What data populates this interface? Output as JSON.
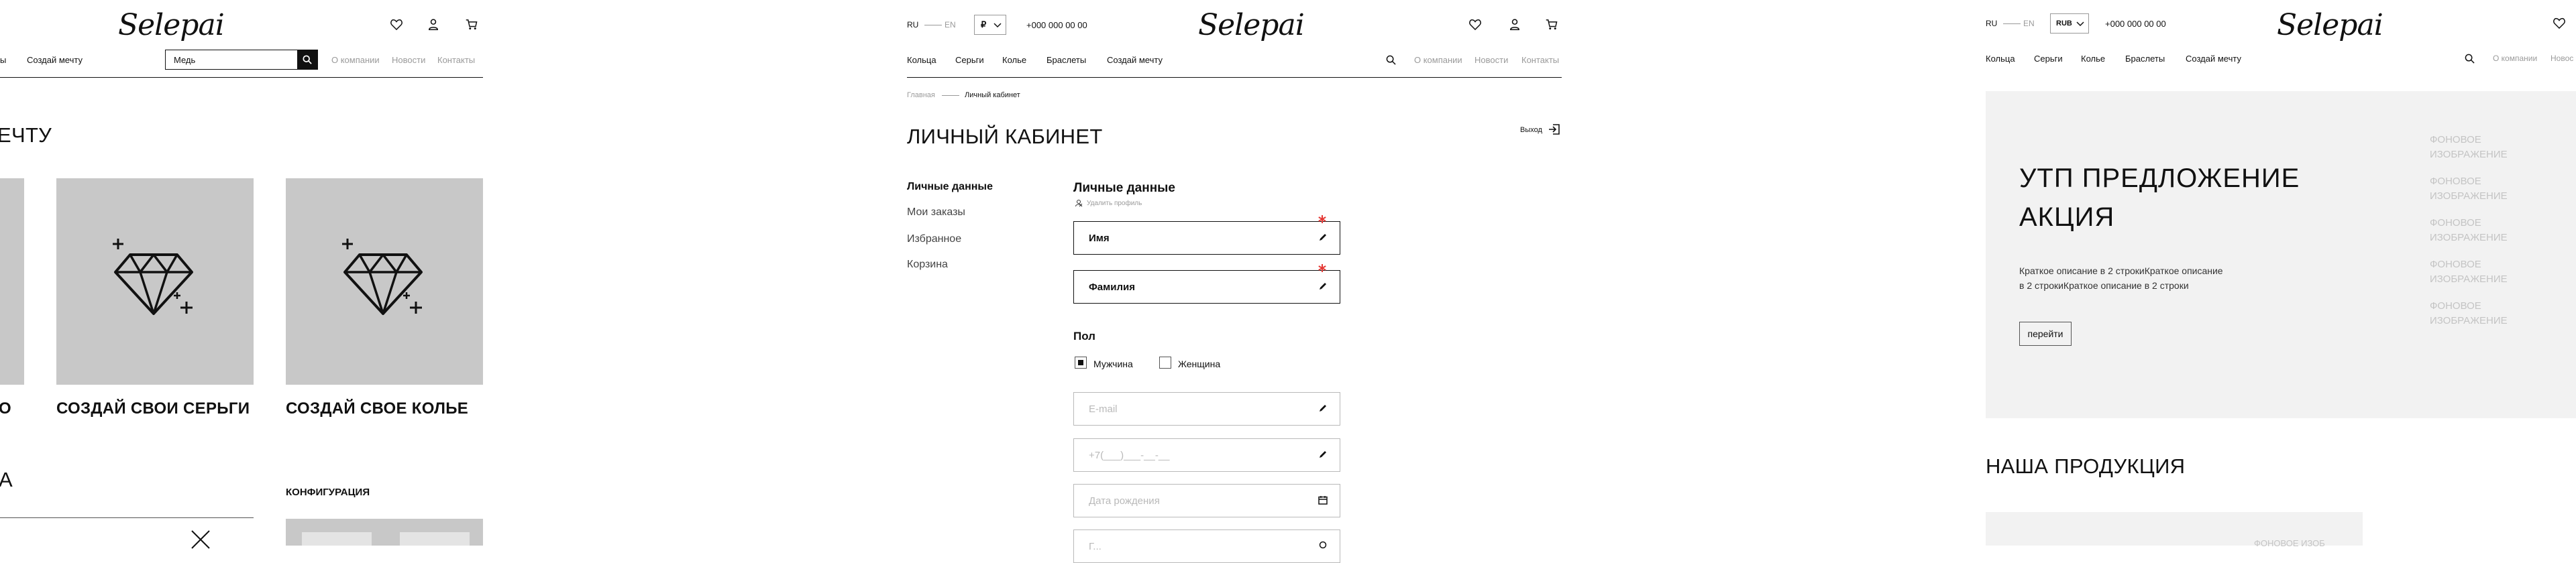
{
  "left": {
    "logo": "Selepai",
    "nav_partial": "ы",
    "nav_create": "Создай мечту",
    "search_value": "Медь",
    "info_links": [
      "О компании",
      "Новости",
      "Контакты"
    ],
    "heading_partial": "ЕЧТУ",
    "card_label_0": "О",
    "card_label_1": "СОЗДАЙ СВОИ СЕРЬГИ",
    "card_label_2": "СОЗДАЙ СВОЕ КОЛЬЕ",
    "heading2_partial": "А",
    "config_label": "КОНФИГУРАЦИЯ"
  },
  "middle": {
    "lang_ru": "RU",
    "lang_en": "EN",
    "currency": "₽",
    "phone": "+000 000 00 00",
    "logo": "Selepai",
    "nav": [
      "Кольца",
      "Серьги",
      "Колье",
      "Браслеты",
      "Создай мечту"
    ],
    "info_links": [
      "О компании",
      "Новости",
      "Контакты"
    ],
    "breadcrumb": {
      "home": "Главная",
      "current": "Личный кабинет"
    },
    "page_title": "ЛИЧНЫЙ КАБИНЕТ",
    "logout": "Выход",
    "sidebar": [
      "Личные данные",
      "Мои заказы",
      "Избранное",
      "Корзина"
    ],
    "section_title": "Личные данные",
    "delete_profile": "Удалить профиль",
    "first_name": "Имя",
    "last_name": "Фамилия",
    "gender_title": "Пол",
    "gender_male": "Мужчина",
    "gender_female": "Женщина",
    "email_placeholder": "E-mail",
    "phone_placeholder": "+7(___)___-__-__",
    "birthdate_placeholder": "Дата рождения",
    "bottom_partial": "Г..."
  },
  "right": {
    "lang_ru": "RU",
    "lang_en": "EN",
    "currency": "RUB",
    "phone": "+000 000 00 00",
    "logo": "Selepai",
    "nav": [
      "Кольца",
      "Серьги",
      "Колье",
      "Браслеты",
      "Создай мечту"
    ],
    "info_partial": "О компании",
    "info_partial2": "Новос",
    "promo_title_1": "УТП ПРЕДЛОЖЕНИЕ",
    "promo_title_2": "АКЦИЯ",
    "promo_desc_1": "Краткое описание в 2 строкиКраткое описание",
    "promo_desc_2": "в 2 строкиКраткое описание в 2 строки",
    "promo_button": "перейти",
    "bg_labels": [
      "ФОНОВОЕ ИЗОБРАЖЕНИЕ",
      "ФОНОВОЕ ИЗОБРАЖЕНИЕ",
      "ФОНОВОЕ ИЗОБРАЖЕНИЕ",
      "ФОНОВОЕ ИЗОБРАЖЕНИЕ",
      "ФОНОВОЕ ИЗОБРАЖЕНИЕ"
    ],
    "products_title": "НАША ПРОДУКЦИЯ",
    "bottom_partial": "ФОНОВОЕ ИЗОБ"
  },
  "colors": {
    "accent": "#e53935",
    "placeholder_grey": "#c8c8c8",
    "promo_bg": "#f2f2f2"
  }
}
